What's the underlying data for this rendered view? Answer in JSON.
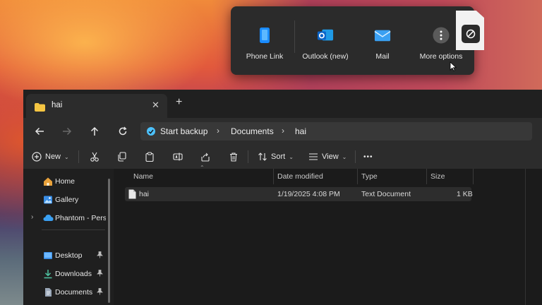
{
  "share": {
    "items": [
      {
        "label": "Phone Link",
        "icon": "phone-link-icon"
      },
      {
        "label": "Outlook (new)",
        "icon": "outlook-icon"
      },
      {
        "label": "Mail",
        "icon": "mail-icon"
      },
      {
        "label": "More options",
        "icon": "more-options-icon"
      }
    ]
  },
  "tab": {
    "title": "hai",
    "close": "✕",
    "new": "+"
  },
  "breadcrumb": {
    "root": "Start backup",
    "items": [
      "Documents",
      "hai"
    ],
    "separator": "›"
  },
  "toolbar": {
    "new_label": "New",
    "sort_label": "Sort",
    "view_label": "View",
    "more": "•••"
  },
  "sidebar": {
    "items": [
      {
        "label": "Home",
        "icon": "home-icon"
      },
      {
        "label": "Gallery",
        "icon": "gallery-icon"
      },
      {
        "label": "Phantom - Persc",
        "icon": "onedrive-cloud-icon"
      },
      {
        "label": "Desktop",
        "icon": "desktop-icon",
        "pinned": true
      },
      {
        "label": "Downloads",
        "icon": "download-icon",
        "pinned": true
      },
      {
        "label": "Documents",
        "icon": "documents-icon",
        "pinned": true
      }
    ],
    "pin_glyph": "📌"
  },
  "columns": {
    "name": "Name",
    "date": "Date modified",
    "type": "Type",
    "size": "Size"
  },
  "files": [
    {
      "name": "hai",
      "date": "1/19/2025 4:08 PM",
      "type": "Text Document",
      "size": "1 KB"
    }
  ],
  "colors": {
    "accent": "#4cc2ff",
    "folder": "#f5c542",
    "window_bg": "#1f1f1f"
  }
}
